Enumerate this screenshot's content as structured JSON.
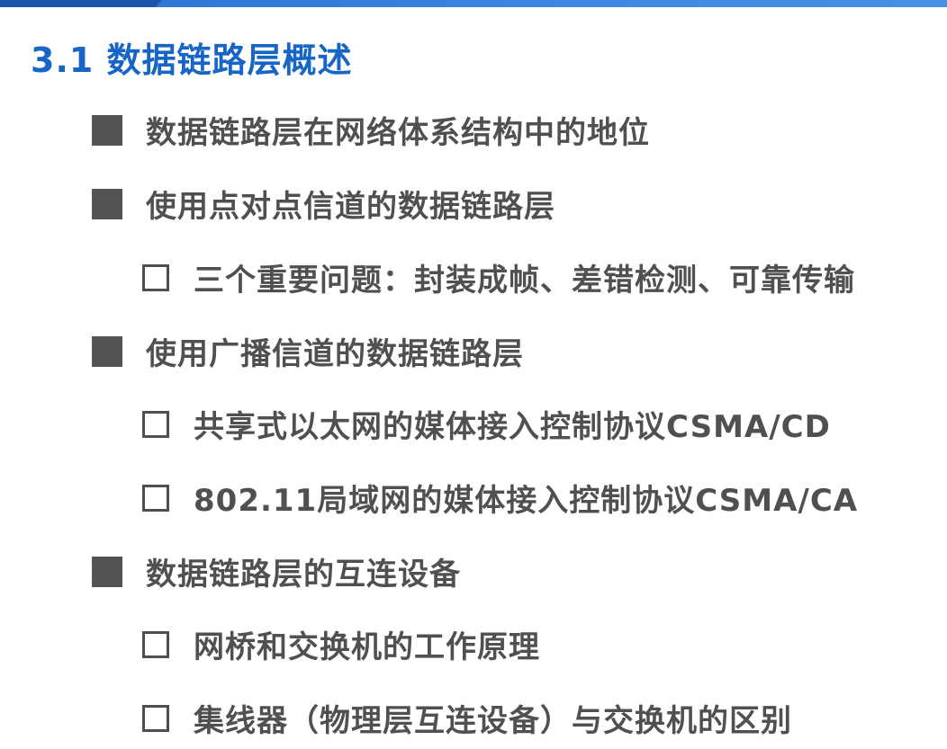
{
  "slide": {
    "title": "3.1 数据链路层概述"
  },
  "outline": [
    {
      "level": 1,
      "bullet": "filled-square",
      "text": "数据链路层在网络体系结构中的地位"
    },
    {
      "level": 1,
      "bullet": "filled-square",
      "text": "使用点对点信道的数据链路层"
    },
    {
      "level": 2,
      "bullet": "hollow-square",
      "text": "三个重要问题：封装成帧、差错检测、可靠传输"
    },
    {
      "level": 1,
      "bullet": "filled-square",
      "text": "使用广播信道的数据链路层"
    },
    {
      "level": 2,
      "bullet": "hollow-square",
      "text": "共享式以太网的媒体接入控制协议CSMA/CD"
    },
    {
      "level": 2,
      "bullet": "hollow-square",
      "text": "802.11局域网的媒体接入控制协议CSMA/CA"
    },
    {
      "level": 1,
      "bullet": "filled-square",
      "text": "数据链路层的互连设备"
    },
    {
      "level": 2,
      "bullet": "hollow-square",
      "text": "网桥和交换机的工作原理"
    },
    {
      "level": 2,
      "bullet": "hollow-square",
      "text": "集线器（物理层互连设备）与交换机的区别"
    }
  ],
  "colors": {
    "title": "#1766c7",
    "text": "#505050",
    "bullet": "#545454",
    "top_bar": "#3f86e3"
  }
}
